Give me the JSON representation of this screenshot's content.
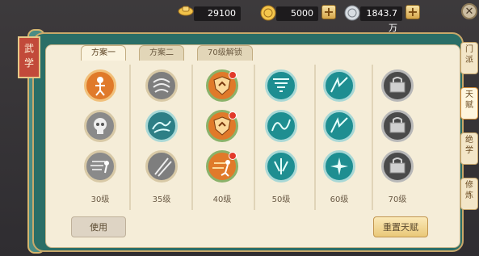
{
  "resources": {
    "ingot": {
      "icon": "gold-ingot-icon",
      "value": "29100"
    },
    "coin": {
      "icon": "gold-coin-icon",
      "value": "5000"
    },
    "silver": {
      "icon": "silver-coin-icon",
      "value": "1843.7万"
    }
  },
  "banner": {
    "title": "武\n学"
  },
  "tabs": [
    {
      "label": "方案一",
      "active": true
    },
    {
      "label": "方案二",
      "active": false
    },
    {
      "label": "70级解锁",
      "active": false
    }
  ],
  "levels": [
    "30级",
    "35级",
    "40级",
    "50级",
    "60级",
    "70级"
  ],
  "skills": {
    "col1": [
      {
        "icon": "stickman-orange-icon",
        "ring": "orange"
      },
      {
        "icon": "skull-grey-icon",
        "ring": "grey"
      },
      {
        "icon": "runner-grey-icon",
        "ring": "grey"
      }
    ],
    "col2": [
      {
        "icon": "wind-grey-icon",
        "ring": "grey"
      },
      {
        "icon": "dragon-teal-icon",
        "ring": "teal"
      },
      {
        "icon": "slash-grey-icon",
        "ring": "grey"
      }
    ],
    "col3": [
      {
        "icon": "shield-orange-icon",
        "ring": "orange",
        "dot": true
      },
      {
        "icon": "shield-orange-icon",
        "ring": "orange",
        "dot": true
      },
      {
        "icon": "runner-orange-icon",
        "ring": "orange",
        "dot": true
      }
    ],
    "col4": [
      {
        "icon": "tornado-teal-icon",
        "ring": "teal"
      },
      {
        "icon": "wave-teal-icon",
        "ring": "teal"
      },
      {
        "icon": "splash-teal-icon",
        "ring": "teal"
      }
    ],
    "col5": [
      {
        "icon": "storm-teal-icon",
        "ring": "teal"
      },
      {
        "icon": "storm-teal-icon",
        "ring": "teal"
      },
      {
        "icon": "sparkle-teal-icon",
        "ring": "teal"
      }
    ],
    "col6": [
      {
        "icon": "locked-chest-icon",
        "ring": "grey"
      },
      {
        "icon": "locked-chest-icon",
        "ring": "grey"
      },
      {
        "icon": "locked-chest-icon",
        "ring": "grey"
      }
    ]
  },
  "buttons": {
    "use": "使用",
    "reset": "重置天赋"
  },
  "side_tabs": [
    {
      "label": "门\n派",
      "active": false
    },
    {
      "label": "天\n赋",
      "active": true
    },
    {
      "label": "绝\n学",
      "active": false
    },
    {
      "label": "修\n炼",
      "active": false
    }
  ],
  "colors": {
    "teal": "#2a6e67",
    "orange": "#e07a2a",
    "grey": "#8a8a8a",
    "gold": "#e0b04a"
  }
}
